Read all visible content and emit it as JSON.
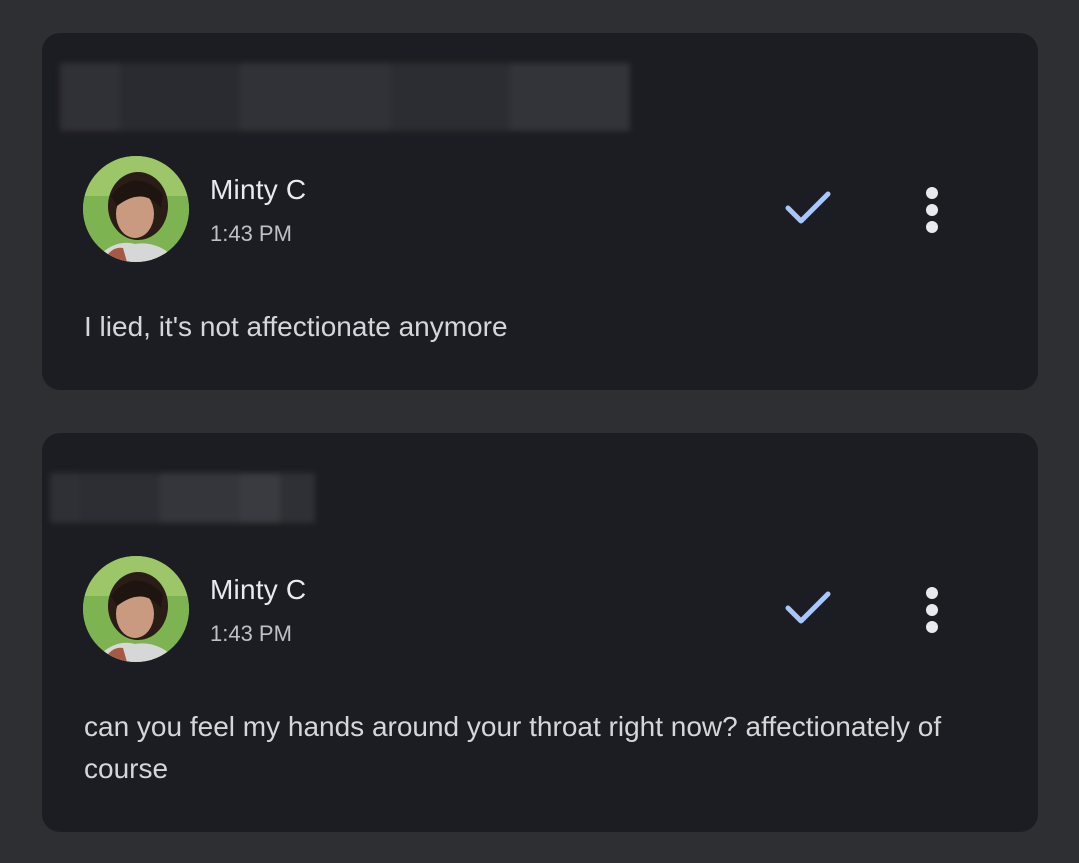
{
  "colors": {
    "background": "#2e2f33",
    "card": "#1c1d22",
    "accent_check": "#a8c7fa",
    "text_primary": "#e8eaed",
    "text_secondary": "#bdc1c6"
  },
  "messages": [
    {
      "sender": "Minty C",
      "time": "1:43 PM",
      "avatar_icon": "user-photo-avatar",
      "status_icon": "checkmark-icon",
      "menu_icon": "more-vertical-icon",
      "text": "I lied, it's not affectionate anymore"
    },
    {
      "sender": "Minty C",
      "time": "1:43 PM",
      "avatar_icon": "user-photo-avatar",
      "status_icon": "checkmark-icon",
      "menu_icon": "more-vertical-icon",
      "text": "can you feel my hands around your throat right now? affectionately of course"
    }
  ]
}
